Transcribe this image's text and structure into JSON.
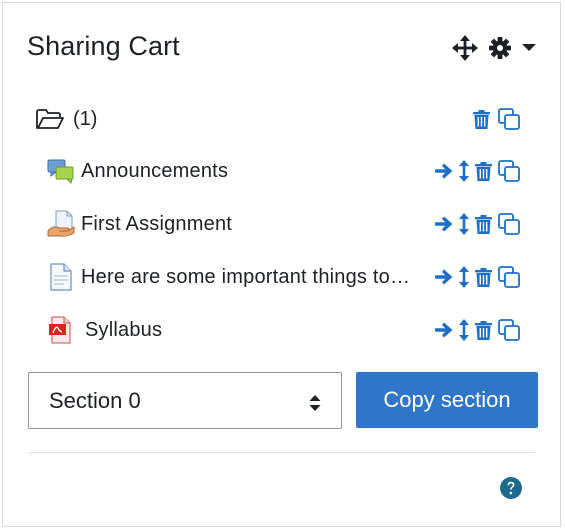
{
  "block": {
    "title": "Sharing Cart",
    "header_icons": [
      "move-icon",
      "gear-icon",
      "caret-down-icon"
    ]
  },
  "folder": {
    "icon": "folder-open-icon",
    "count_label": "(1)",
    "actions": [
      "trash-icon",
      "copy-icon"
    ]
  },
  "items": [
    {
      "label": "Announcements",
      "icon": "forum-icon",
      "actions": [
        "move-right-icon",
        "move-vertical-icon",
        "trash-icon",
        "copy-icon"
      ]
    },
    {
      "label": "First Assignment",
      "icon": "assignment-icon",
      "actions": [
        "move-right-icon",
        "move-vertical-icon",
        "trash-icon",
        "copy-icon"
      ]
    },
    {
      "label": "Here are some important things to know",
      "icon": "page-icon",
      "actions": [
        "move-right-icon",
        "move-vertical-icon",
        "trash-icon",
        "copy-icon"
      ]
    },
    {
      "label": "Syllabus",
      "icon": "pdf-icon",
      "actions": [
        "move-right-icon",
        "move-vertical-icon",
        "trash-icon",
        "copy-icon"
      ]
    }
  ],
  "section_select": {
    "selected": "Section 0"
  },
  "copy_button": {
    "label": "Copy section"
  },
  "help": {
    "icon": "help-icon"
  },
  "colors": {
    "accent": "#1f6fc5",
    "button_bg": "#2f76c9",
    "help": "#1d6a8c",
    "text": "#1d2125"
  }
}
